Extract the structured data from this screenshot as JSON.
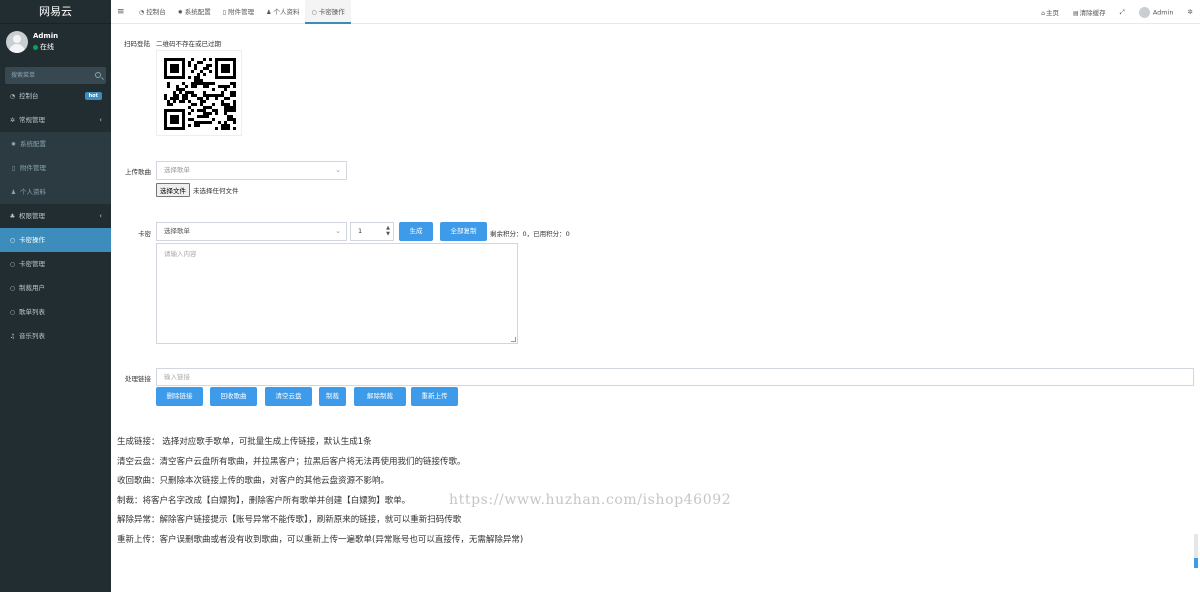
{
  "app": {
    "title": "网易云"
  },
  "user": {
    "name": "Admin",
    "status": "在线"
  },
  "sidebar": {
    "search_placeholder": "搜索菜单",
    "items": [
      {
        "label": "控制台",
        "icon": "dashboard-icon",
        "badge": "hot"
      },
      {
        "label": "常规管理",
        "icon": "cogs-icon",
        "has_children": true
      },
      {
        "label": "系统配置",
        "icon": "cog-icon",
        "sub": true
      },
      {
        "label": "附件管理",
        "icon": "file-icon",
        "sub": true
      },
      {
        "label": "个人资料",
        "icon": "user-icon",
        "sub": true
      },
      {
        "label": "权限管理",
        "icon": "group-icon",
        "has_children": true
      },
      {
        "label": "卡密操作",
        "icon": "circle-icon",
        "active": true
      },
      {
        "label": "卡密管理",
        "icon": "circle-icon"
      },
      {
        "label": "制裁用户",
        "icon": "circle-icon"
      },
      {
        "label": "歌单列表",
        "icon": "circle-icon"
      },
      {
        "label": "音乐列表",
        "icon": "music-icon"
      }
    ]
  },
  "topbar": {
    "tabs": [
      {
        "label": "控制台",
        "icon": "dashboard-icon"
      },
      {
        "label": "系统配置",
        "icon": "cog-icon"
      },
      {
        "label": "附件管理",
        "icon": "file-icon"
      },
      {
        "label": "个人资料",
        "icon": "user-icon"
      },
      {
        "label": "卡密操作",
        "icon": "circle-icon",
        "active": true
      }
    ],
    "home": "主页",
    "clear_cache": "清除缓存",
    "user": "Admin"
  },
  "form": {
    "qr_label": "扫码登陆",
    "qr_note": "二维码不存在或已过期",
    "upload_label": "上传歌曲",
    "upload_select_placeholder": "选择歌单",
    "file_button": "选择文件",
    "file_status": "未选择任何文件",
    "card_label": "卡密",
    "card_select_placeholder": "选择歌单",
    "card_count": "1",
    "generate_button": "生成",
    "copy_all_button": "全部复制",
    "stats": "剩余积分：0，已用积分：0",
    "textarea_placeholder": "请输入内容",
    "link_label": "处理链接",
    "link_placeholder": "输入链接",
    "actions": [
      "删除链接",
      "回收歌曲",
      "清空云盘",
      "制裁",
      "解除制裁",
      "重新上传"
    ]
  },
  "help": [
    "生成链接：  选择对应歌手歌单，可批量生成上传链接，默认生成1条",
    "清空云盘：清空客户云盘所有歌曲，并拉黑客户；拉黑后客户将无法再使用我们的链接传歌。",
    "收回歌曲：只删除本次链接上传的歌曲，对客户的其他云盘资源不影响。",
    "制裁：将客户名字改成【白嫖狗】，删除客户所有歌单并创建【白嫖狗】歌单。",
    "解除异常：解除客户链接提示【账号异常不能传歌】，刷新原来的链接，就可以重新扫码传歌",
    "重新上传：客户误删歌曲或者没有收到歌曲，可以重新上传一遍歌单(异常账号也可以直接传，无需解除异常)"
  ],
  "watermark": "https://www.huzhan.com/ishop46092"
}
